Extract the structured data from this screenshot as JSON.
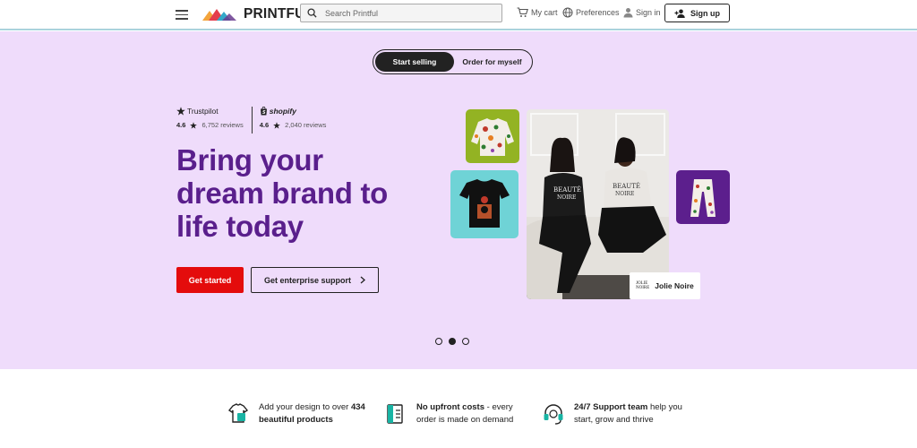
{
  "header": {
    "logo_text": "PRINTFUL",
    "search_placeholder": "Search Printful",
    "cart_label": "My cart",
    "preferences_label": "Preferences",
    "signin_label": "Sign in",
    "signup_label": "Sign up"
  },
  "hero": {
    "toggle": {
      "active": "Start selling",
      "inactive": "Order for myself"
    },
    "ratings": [
      {
        "brand": "Trustpilot",
        "score": "4.6",
        "reviews": "6,752 reviews"
      },
      {
        "brand": "shopify",
        "score": "4.6",
        "reviews": "2,040 reviews"
      }
    ],
    "headline_lines": [
      "Bring your",
      "dream brand to",
      "life today"
    ],
    "primary_cta": "Get started",
    "secondary_cta": "Get enterprise support",
    "collage": {
      "brand_name": "Jolie Noire",
      "tag_logo_line1": "JOLIE",
      "tag_logo_line2": "NOIRE",
      "shirt_text_1": "BEAUTÉ",
      "shirt_text_1b": "NOIRE",
      "shirt_text_2": "BEAUTÉ",
      "shirt_text_2b": "NOIRE"
    },
    "carousel": {
      "count": 3,
      "active_index": 1
    }
  },
  "features": [
    {
      "pre": "Add your design to over ",
      "bold": "434",
      "line2_bold": "beautiful products",
      "line2": "",
      "icon": "tshirt-icon"
    },
    {
      "pre": "",
      "bold": "No upfront costs",
      "rest": " - every",
      "line2": "order is made on demand",
      "icon": "receipt-icon"
    },
    {
      "pre": "",
      "bold": "24/7 Support team",
      "rest": " help you",
      "line2": "start, grow and thrive",
      "icon": "headset-icon"
    }
  ],
  "colors": {
    "hero_bg": "#efdcfb",
    "headline": "#5a1f8c",
    "primary_cta": "#e40c0c",
    "accent_teal": "#19b4a4"
  }
}
